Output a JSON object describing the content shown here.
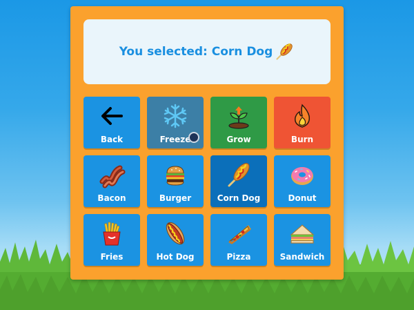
{
  "display": {
    "prefix": "You selected:",
    "selection": "Corn Dog",
    "icon": "corn-dog-icon"
  },
  "colors": {
    "panel": "#fba12d",
    "tile": "#1b93e2",
    "selected_tile": "#0b6fba",
    "freeze": "#3c7fa6",
    "grow": "#2f9a46",
    "burn": "#ef5434",
    "text_accent": "#1a8fe0"
  },
  "tiles": [
    {
      "label": "Back",
      "icon": "back-arrow-icon"
    },
    {
      "label": "Freeze",
      "icon": "snowflake-icon"
    },
    {
      "label": "Grow",
      "icon": "sprout-icon"
    },
    {
      "label": "Burn",
      "icon": "flame-icon"
    },
    {
      "label": "Bacon",
      "icon": "bacon-icon"
    },
    {
      "label": "Burger",
      "icon": "burger-icon"
    },
    {
      "label": "Corn Dog",
      "icon": "corn-dog-icon",
      "selected": true
    },
    {
      "label": "Donut",
      "icon": "donut-icon"
    },
    {
      "label": "Fries",
      "icon": "fries-icon"
    },
    {
      "label": "Hot Dog",
      "icon": "hot-dog-icon"
    },
    {
      "label": "Pizza",
      "icon": "pizza-icon"
    },
    {
      "label": "Sandwich",
      "icon": "sandwich-icon"
    }
  ]
}
